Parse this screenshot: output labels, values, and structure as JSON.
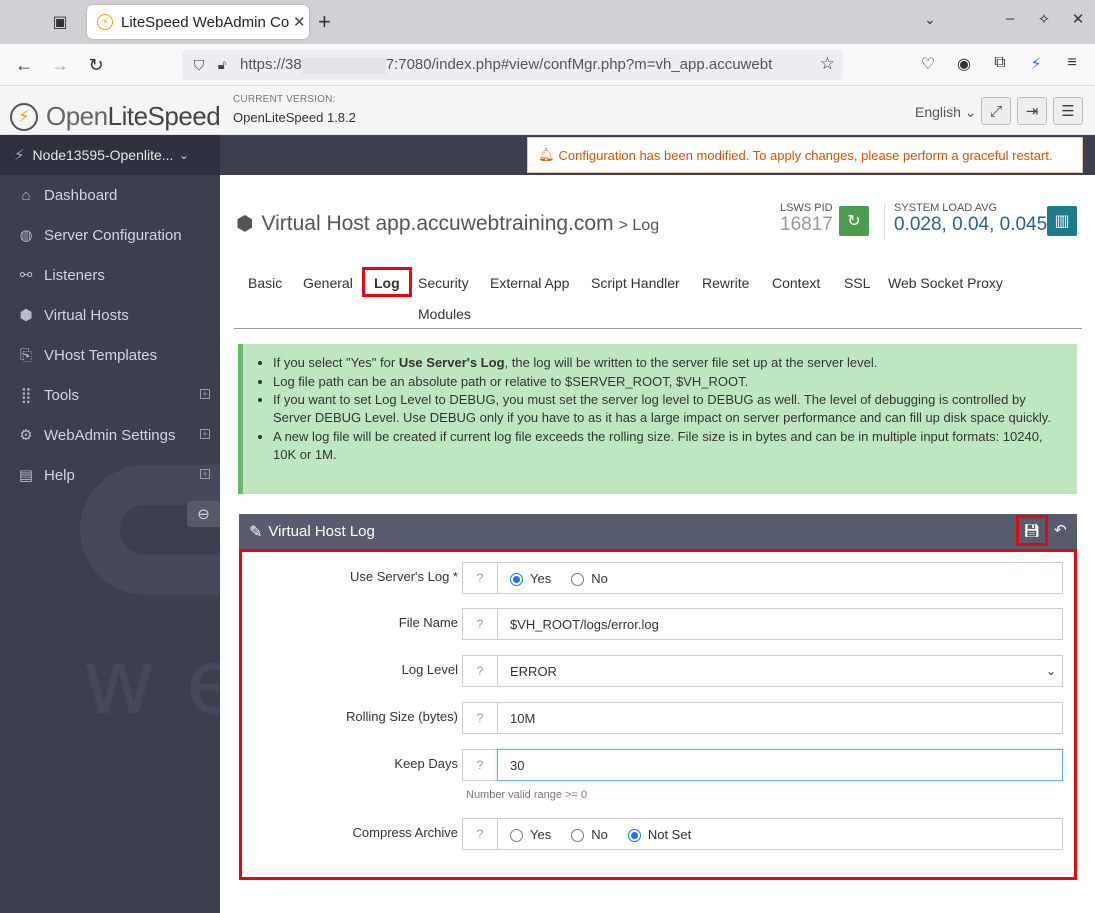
{
  "browser": {
    "tab_title": "LiteSpeed WebAdmin Co",
    "url_prefix": "https://38",
    "url_suffix": "7:7080/index.php#view/confMgr.php?m=vh_app.accuwebt"
  },
  "header": {
    "logo_open": "Open",
    "logo_lite": "LiteSpeed",
    "version_label": "CURRENT VERSION:",
    "version_value": "OpenLiteSpeed 1.8.2",
    "language": "English"
  },
  "sidebar": {
    "node": "Node13595-Openlite...",
    "items": [
      {
        "label": "Dashboard",
        "icon": "home-icon"
      },
      {
        "label": "Server Configuration",
        "icon": "globe-icon"
      },
      {
        "label": "Listeners",
        "icon": "link-icon"
      },
      {
        "label": "Virtual Hosts",
        "icon": "cubes-icon"
      },
      {
        "label": "VHost Templates",
        "icon": "copy-icon"
      },
      {
        "label": "Tools",
        "icon": "grid-icon"
      },
      {
        "label": "WebAdmin Settings",
        "icon": "gear-icon"
      },
      {
        "label": "Help",
        "icon": "book-icon"
      }
    ]
  },
  "alert": "Configuration has been modified. To apply changes, please perform a graceful restart.",
  "page": {
    "title": "Virtual Host app.accuwebtraining.com",
    "subtitle": "> Log",
    "pid_label": "LSWS PID",
    "pid_value": "16817",
    "load_label": "SYSTEM LOAD AVG",
    "load_value": "0.028, 0.04, 0.045"
  },
  "tabs": [
    "Basic",
    "General",
    "Log",
    "Security",
    "External App",
    "Script Handler",
    "Rewrite",
    "Context",
    "SSL",
    "Web Socket Proxy",
    "Modules"
  ],
  "info": {
    "line1_pre": "If you select \"Yes\" for ",
    "line1_bold": "Use Server's Log",
    "line1_post": ", the log will be written to the server file set up at the server level.",
    "line2": "Log file path can be an absolute path or relative to $SERVER_ROOT, $VH_ROOT.",
    "line3": "If you want to set Log Level to DEBUG, you must set the server log level to DEBUG as well. The level of debugging is controlled by Server DEBUG Level. Use DEBUG only if you have to as it has a large impact on server performance and can fill up disk space quickly.",
    "line4": "A new log file will be created if current log file exceeds the rolling size. File size is in bytes and can be in multiple input formats: 10240, 10K or 1M."
  },
  "panel": {
    "title": "Virtual Host Log"
  },
  "form": {
    "use_server_log_label": "Use Server's Log *",
    "yes": "Yes",
    "no": "No",
    "not_set": "Not Set",
    "file_name_label": "File Name",
    "file_name_value": "$VH_ROOT/logs/error.log",
    "log_level_label": "Log Level",
    "log_level_value": "ERROR",
    "rolling_size_label": "Rolling Size (bytes)",
    "rolling_size_value": "10M",
    "keep_days_label": "Keep Days",
    "keep_days_value": "30",
    "keep_days_hint": "Number valid range >= 0",
    "compress_label": "Compress Archive"
  }
}
